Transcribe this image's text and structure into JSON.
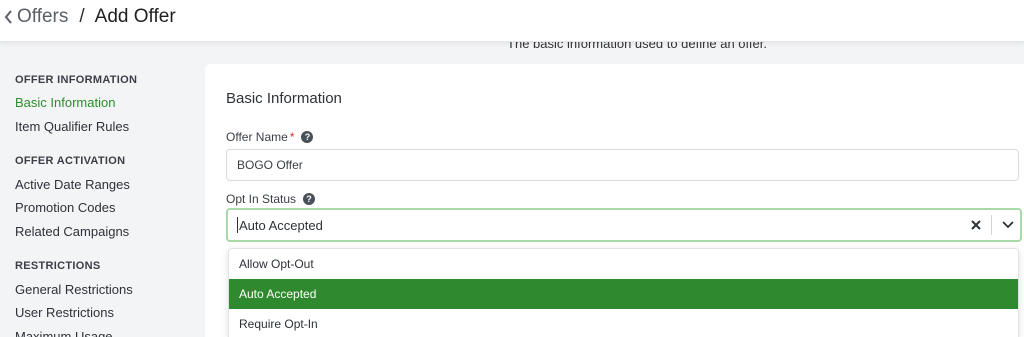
{
  "breadcrumb": {
    "back_label": "Offers",
    "separator": "/",
    "current": "Add Offer"
  },
  "subtitle": "The basic information used to define an offer.",
  "sidebar": {
    "sections": [
      {
        "heading": "OFFER INFORMATION",
        "items": [
          "Basic Information",
          "Item Qualifier Rules"
        ]
      },
      {
        "heading": "OFFER ACTIVATION",
        "items": [
          "Active Date Ranges",
          "Promotion Codes",
          "Related Campaigns"
        ]
      },
      {
        "heading": "RESTRICTIONS",
        "items": [
          "General Restrictions",
          "User Restrictions",
          "Maximum Usage"
        ]
      }
    ],
    "active_item": "Basic Information"
  },
  "card": {
    "title": "Basic Information",
    "offer_name": {
      "label": "Offer Name",
      "required_mark": "*",
      "value": "BOGO Offer"
    },
    "opt_in_status": {
      "label": "Opt In Status",
      "value": "Auto Accepted",
      "options": [
        "Allow Opt-Out",
        "Auto Accepted",
        "Require Opt-In"
      ],
      "selected_index": 1
    }
  },
  "colors": {
    "accent": "#2f8a2f",
    "focus_border": "#a9d9a9",
    "required": "#d32f2f"
  }
}
